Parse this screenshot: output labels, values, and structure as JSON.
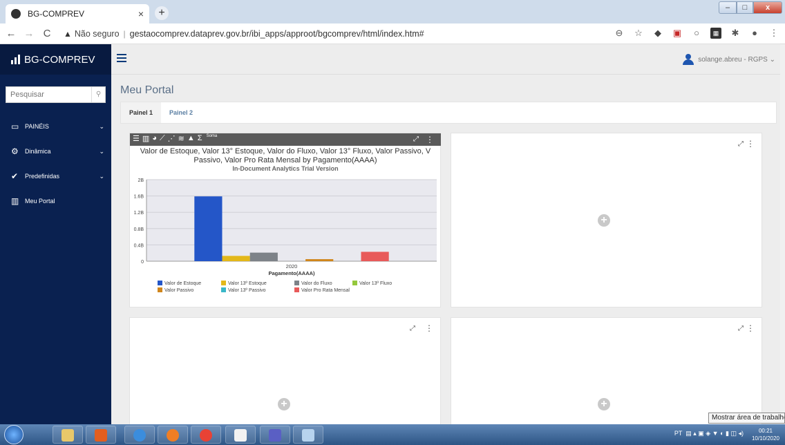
{
  "browser": {
    "tab_title": "BG-COMPREV",
    "tab_close": "×",
    "newtab": "+",
    "not_secure": "Não seguro",
    "url": "gestaocomprev.dataprev.gov.br/ibi_apps/approot/bgcomprev/html/index.htm#"
  },
  "sidebar": {
    "brand": "BG-COMPREV",
    "search_placeholder": "Pesquisar",
    "items": [
      {
        "label": "PAINÉIS",
        "icon": "monitor-icon",
        "chev": "⌄"
      },
      {
        "label": "Dinâmica",
        "icon": "cogs-icon",
        "chev": "⌄"
      },
      {
        "label": "Predefinidas",
        "icon": "check-icon",
        "chev": "⌄"
      },
      {
        "label": "Meu Portal",
        "icon": "bar-chart-icon",
        "chev": ""
      }
    ]
  },
  "topbar": {
    "user": "solange.abreu - RGPS ⌄"
  },
  "main": {
    "title": "Meu Portal",
    "tabs": [
      "Painel 1",
      "Painel 2"
    ]
  },
  "chart_panel": {
    "soma": "Soma",
    "title_line1": "Valor de Estoque, Valor 13° Estoque, Valor do Fluxo, Valor 13° Fluxo, Valor Passivo, V",
    "title_line2": "Passivo, Valor Pro Rata Mensal by Pagamento(AAAA)",
    "subtitle": "In-Document Analytics Trial Version"
  },
  "chart_data": {
    "type": "bar",
    "title": "Valor de Estoque, Valor 13° Estoque, Valor do Fluxo, Valor 13° Fluxo, Valor Passivo, V Passivo, Valor Pro Rata Mensal by Pagamento(AAAA)",
    "xlabel": "Pagamento(AAAA)",
    "ylabel": "",
    "categories": [
      "2020"
    ],
    "ylim": [
      0,
      2000000000
    ],
    "yticks": [
      "0",
      "0.4B",
      "0.8B",
      "1.2B",
      "1.6B",
      "2B"
    ],
    "legend_placement": "bottom",
    "series": [
      {
        "name": "Valor de Estoque",
        "values": [
          1590000000
        ],
        "color": "#2456c8"
      },
      {
        "name": "Valor 13º Estoque",
        "values": [
          130000000
        ],
        "color": "#e3b81a"
      },
      {
        "name": "Valor do Fluxo",
        "values": [
          210000000
        ],
        "color": "#7d8288"
      },
      {
        "name": "Valor 13º Fluxo",
        "values": [
          0
        ],
        "color": "#94c83c"
      },
      {
        "name": "Valor Passivo",
        "values": [
          50000000
        ],
        "color": "#d0861c"
      },
      {
        "name": "Valor 13º Passivo",
        "values": [
          0
        ],
        "color": "#3ab7c8"
      },
      {
        "name": "Valor Pro Rata Mensal",
        "values": [
          230000000
        ],
        "color": "#e85a5a"
      }
    ]
  },
  "taskbar": {
    "lang": "PT",
    "time": "00:21",
    "date": "10/10/2020",
    "tooltip": "Mostrar área de trabalho"
  }
}
